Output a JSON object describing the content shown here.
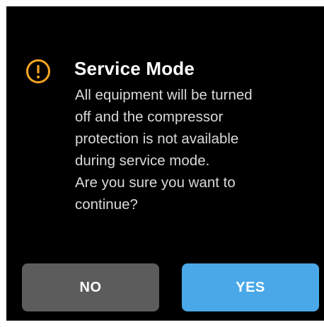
{
  "dialog": {
    "icon": "warning-circle-icon",
    "title": "Service Mode",
    "message_lines": [
      "All equipment will be turned",
      "off and the compressor",
      "protection is not available",
      "during service mode.",
      "Are you sure you want to",
      "continue?"
    ]
  },
  "buttons": {
    "no_label": "NO",
    "yes_label": "YES"
  },
  "colors": {
    "background": "#000000",
    "warning_icon": "#f5a623",
    "no_button": "#5c5c5c",
    "yes_button": "#4aa8e8",
    "title_text": "#ffffff",
    "message_text": "#d9d9d9"
  }
}
